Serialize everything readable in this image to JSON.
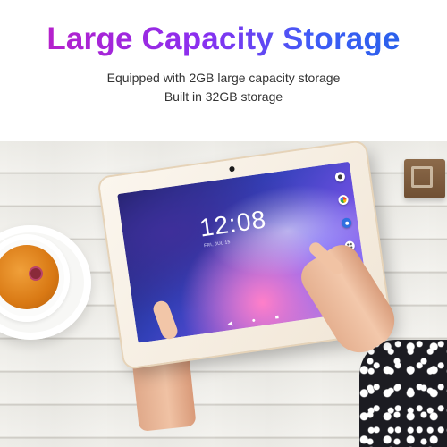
{
  "header": {
    "headline": "Large Capacity Storage",
    "line1": "Equipped with 2GB large capacity storage",
    "line2": "Built in 32GB storage"
  },
  "tablet": {
    "clock_time": "12:08",
    "clock_date": "FRI, JUL 15",
    "screen_icons": [
      "camera-app-icon",
      "photos-app-icon",
      "contacts-app-icon",
      "app-drawer-icon"
    ],
    "nav_icons": [
      "back-icon",
      "home-icon",
      "recents-icon"
    ],
    "nav_glyphs": [
      "◀",
      "●",
      "■"
    ]
  },
  "colors": {
    "headline_gradient_start": "#c21cc0",
    "headline_gradient_end": "#1e63e6",
    "subtext": "#333333"
  }
}
